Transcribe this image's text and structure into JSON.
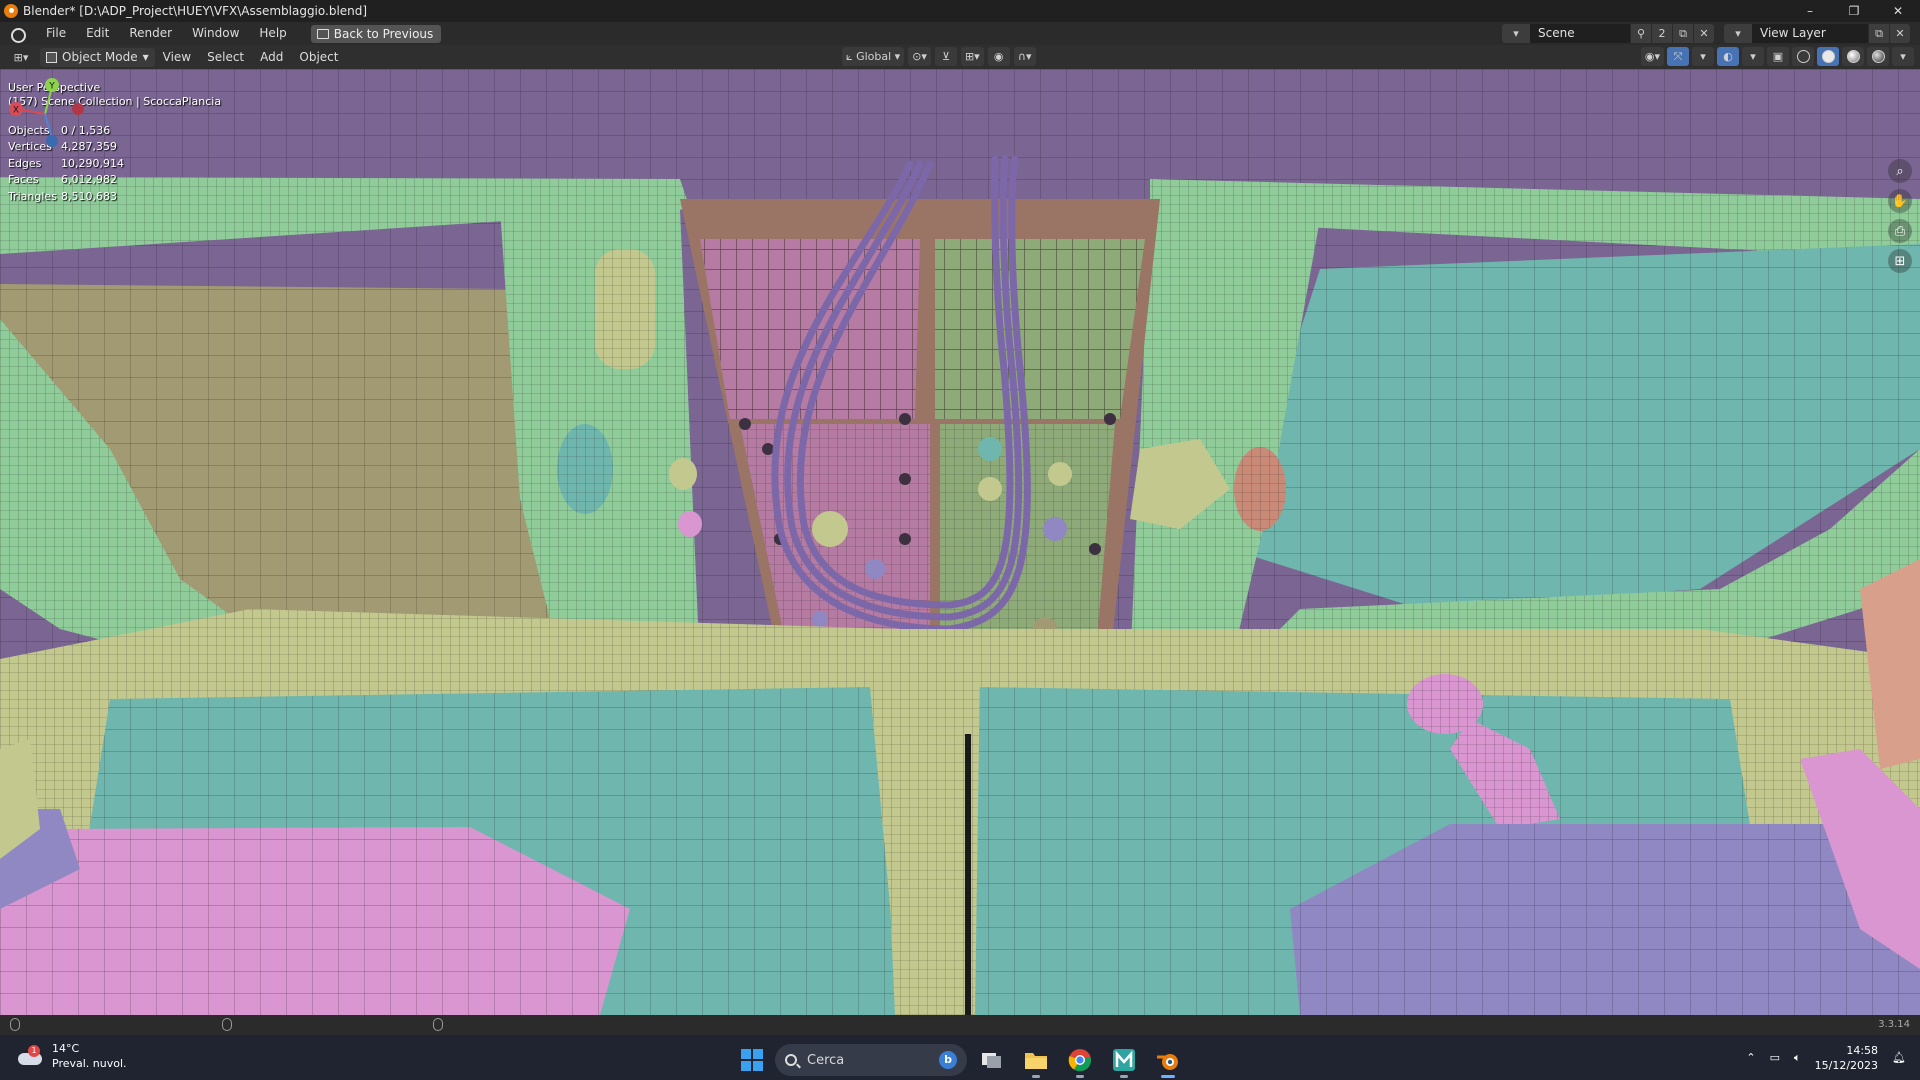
{
  "window": {
    "title": "Blender* [D:\\ADP_Project\\HUEY\\VFX\\Assemblaggio.blend]",
    "minimize_glyph": "–",
    "restore_glyph": "❐",
    "close_glyph": "✕"
  },
  "menubar": {
    "items": [
      "File",
      "Edit",
      "Render",
      "Window",
      "Help"
    ],
    "back_button": "Back to Previous",
    "scene": "Scene",
    "scene_users": "2",
    "view_layer": "View Layer"
  },
  "viewport_header": {
    "mode": "Object Mode",
    "menus": [
      "View",
      "Select",
      "Add",
      "Object"
    ],
    "transform_orientation": "Global"
  },
  "viewport": {
    "perspective": "User Perspective",
    "collection": "(157) Scene Collection | ScoccaPlancia",
    "stats": [
      {
        "label": "Objects",
        "value": "0 / 1,536"
      },
      {
        "label": "Vertices",
        "value": "4,287,359"
      },
      {
        "label": "Edges",
        "value": "10,290,914"
      },
      {
        "label": "Faces",
        "value": "6,012,982"
      },
      {
        "label": "Triangles",
        "value": "8,510,683"
      }
    ],
    "gizmo": {
      "x": "X",
      "y": "Y"
    },
    "colors": {
      "ceiling": "#7a6593",
      "green": "#8fcc9a",
      "olive": "#c3c98e",
      "teal": "#6fb7ae",
      "tan": "#a29a72",
      "pink": "#d996d0",
      "purple": "#8f88c2",
      "panel_brown": "#9a7566",
      "panel_pink": "#b67ba2",
      "panel_green": "#8eaa79",
      "cable": "#7c68a8"
    }
  },
  "statusbar": {
    "version": "3.3.14"
  },
  "taskbar": {
    "weather_temp": "14°C",
    "weather_desc": "Preval. nuvol.",
    "weather_badge": "1",
    "search_placeholder": "Cerca",
    "bing_label": "b",
    "time": "14:58",
    "date": "15/12/2023"
  }
}
